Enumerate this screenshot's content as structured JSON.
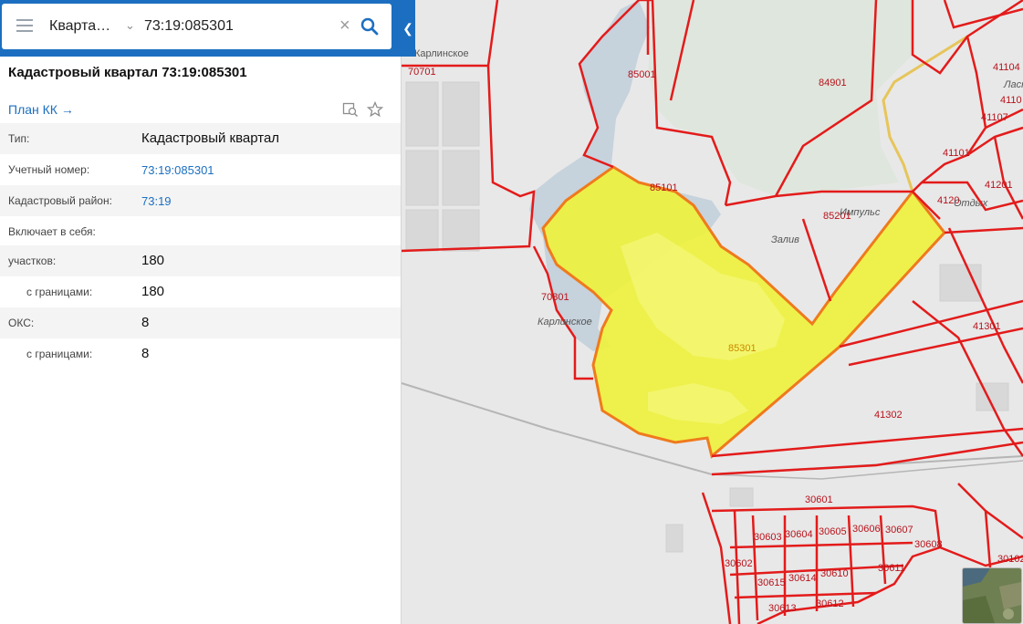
{
  "search": {
    "mode": "Кварта…",
    "query": "73:19:085301"
  },
  "panel": {
    "title": "Кадастровый квартал 73:19:085301",
    "plan_link": "План КК",
    "rows": [
      {
        "label": "Тип:",
        "value": "Кадастровый квартал"
      },
      {
        "label": "Учетный номер:",
        "value": "73:19:085301"
      },
      {
        "label": "Кадастровый район:",
        "value": "73:19"
      },
      {
        "label": "Включает в себя:",
        "value": ""
      },
      {
        "label": "участков:",
        "value": "180"
      },
      {
        "label": "с границами:",
        "value": "180"
      },
      {
        "label": "ОКС:",
        "value": "8"
      },
      {
        "label": "с границами:",
        "value": "8"
      }
    ]
  },
  "map": {
    "highlight_color": "#eef23a",
    "boundary_color": "#e31b1b",
    "quarter_labels": {
      "q70701": "70701",
      "q85001": "85001",
      "q84901": "84901",
      "q85101": "85101",
      "q85201": "85201",
      "q70801": "70801",
      "q85301": "85301",
      "q41104": "41104",
      "q4110": "4110",
      "q41107": "41107",
      "q41101": "41101",
      "q41201": "41201",
      "q4120": "4120",
      "q41301": "41301",
      "q41302": "41302",
      "q30601": "30601",
      "q30603": "30603",
      "q30604": "30604",
      "q30605": "30605",
      "q30606": "30606",
      "q30607": "30607",
      "q30608": "30608",
      "q30602": "30602",
      "q30610": "30610",
      "q30611": "30611",
      "q30614": "30614",
      "q30615": "30615",
      "q30613": "30613",
      "q30612": "30612",
      "q30102": "30102"
    },
    "place_labels": {
      "karlinskoe_top": "Карлинское",
      "karlinskoe_mid": "Карлинское",
      "impuls": "Импульс",
      "zaliv": "Залив",
      "otdykh": "Отдых",
      "lask": "Ласк"
    }
  }
}
